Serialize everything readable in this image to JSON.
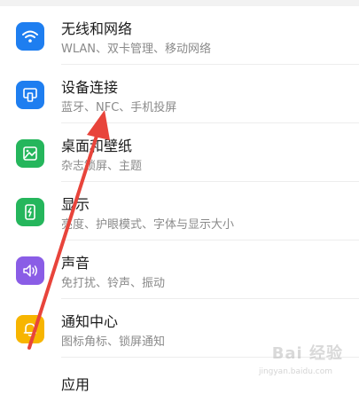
{
  "settings": {
    "items": [
      {
        "title": "无线和网络",
        "subtitle": "WLAN、双卡管理、移动网络",
        "icon": "wifi-icon",
        "color": "#1e7ef0"
      },
      {
        "title": "设备连接",
        "subtitle": "蓝牙、NFC、手机投屏",
        "icon": "device-connection-icon",
        "color": "#1e7ef0"
      },
      {
        "title": "桌面和壁纸",
        "subtitle": "杂志锁屏、主题",
        "icon": "wallpaper-icon",
        "color": "#25b65c"
      },
      {
        "title": "显示",
        "subtitle": "亮度、护眼模式、字体与显示大小",
        "icon": "display-icon",
        "color": "#25b65c"
      },
      {
        "title": "声音",
        "subtitle": "免打扰、铃声、振动",
        "icon": "sound-icon",
        "color": "#8a5de6"
      },
      {
        "title": "通知中心",
        "subtitle": "图标角标、锁屏通知",
        "icon": "bell-icon",
        "color": "#f7b500"
      }
    ],
    "partial_title": "应用"
  },
  "annotation": {
    "color": "#e8443b"
  },
  "watermark": {
    "text": "Bai 经验",
    "sub": "jingyan.baidu.com"
  }
}
